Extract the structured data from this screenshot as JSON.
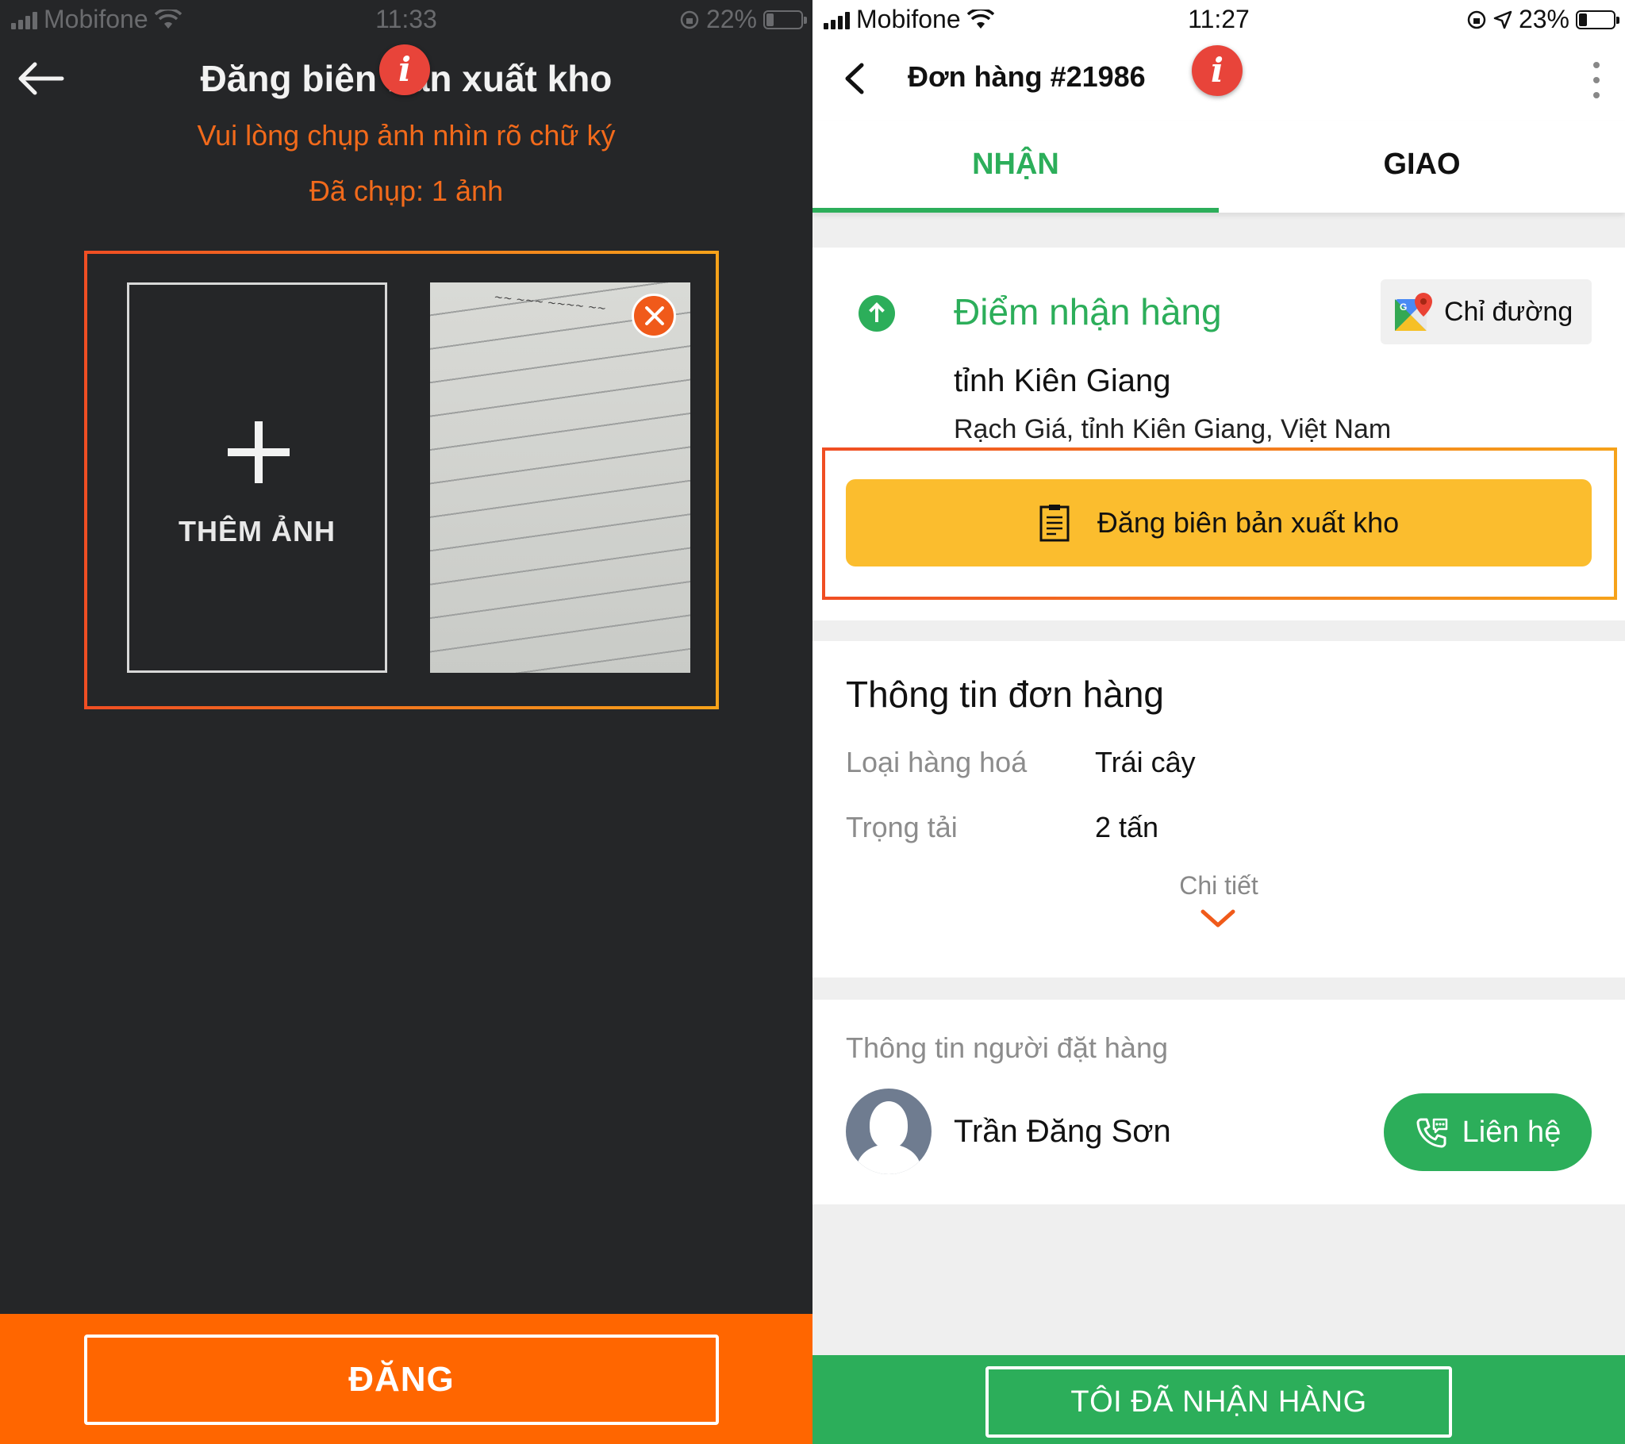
{
  "left_screen": {
    "status": {
      "carrier": "Mobifone",
      "time": "11:33",
      "battery": "22%"
    },
    "title": "Đăng biên bản xuất kho",
    "subtitle": "Vui lòng chụp ảnh nhìn rõ chữ ký",
    "photo_count": "Đã chụp: 1 ảnh",
    "add_photo_label": "THÊM ẢNH",
    "submit_label": "ĐĂNG",
    "info_badge": "i"
  },
  "right_screen": {
    "status": {
      "carrier": "Mobifone",
      "time": "11:27",
      "battery": "23%"
    },
    "order_title": "Đơn hàng #21986",
    "info_badge": "i",
    "tabs": [
      {
        "label": "NHẬN",
        "active": true
      },
      {
        "label": "GIAO",
        "active": false
      }
    ],
    "pickup": {
      "label": "Điểm nhận hàng",
      "directions_label": "Chỉ đường",
      "province": "tỉnh Kiên Giang",
      "address": "Rạch Giá, tỉnh Kiên Giang, Việt Nam",
      "export_button": "Đăng biên bản xuất kho"
    },
    "order_info": {
      "title": "Thông tin đơn hàng",
      "rows": [
        {
          "key": "Loại hàng hoá",
          "value": "Trái cây"
        },
        {
          "key": "Trọng tải",
          "value": "2 tấn"
        }
      ],
      "detail_link": "Chi tiết"
    },
    "customer": {
      "title": "Thông tin người đặt hàng",
      "name": "Trần Đăng Sơn",
      "contact_label": "Liên hệ"
    },
    "bottom_button": "TÔI ĐÃ NHẬN HÀNG"
  },
  "colors": {
    "orange_accent": "#ff6600",
    "highlight_gradient_start": "#f04e23",
    "highlight_gradient_end": "#f6a21a",
    "green_accent": "#2cae5a",
    "yellow_button": "#fbbd2e",
    "info_badge": "#e8443a",
    "dark_background": "#252628"
  },
  "icons": {
    "back": "arrow-left-icon",
    "chevron_back": "chevron-left-icon",
    "info": "info-icon",
    "more": "kebab-menu-icon",
    "pickup": "arrow-up-circle-icon",
    "maps": "google-maps-icon",
    "document": "document-icon",
    "chevron_down": "chevron-down-icon",
    "avatar": "user-avatar-icon",
    "phone": "phone-call-icon",
    "remove": "close-circle-icon",
    "add": "plus-icon"
  }
}
